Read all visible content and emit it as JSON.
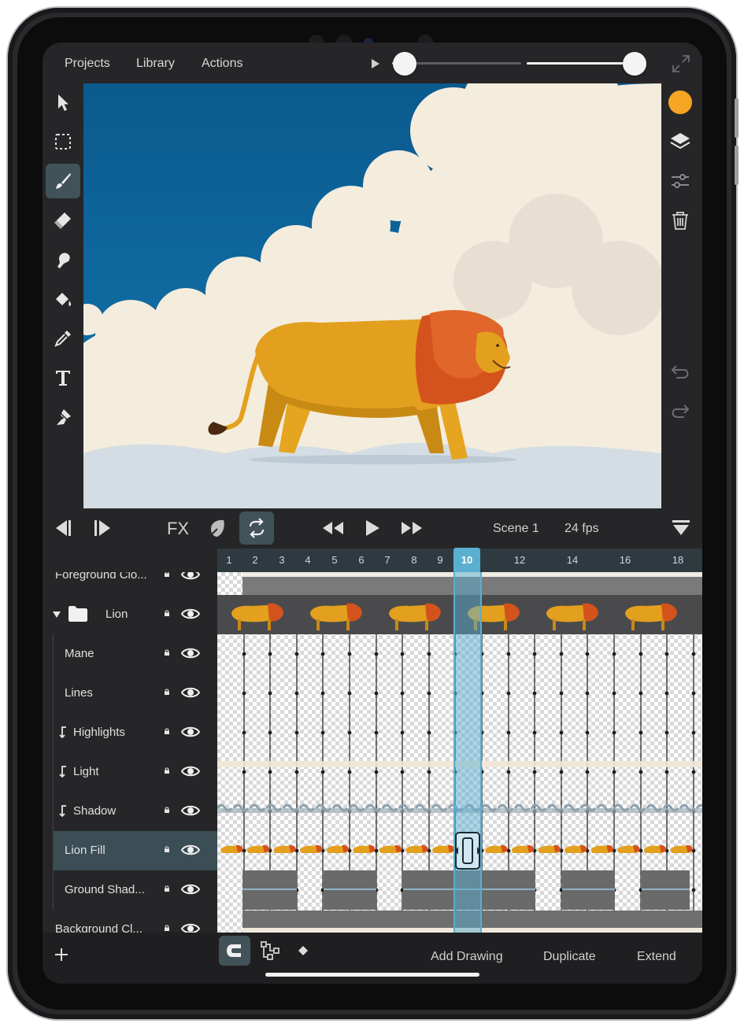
{
  "menu": {
    "projects": "Projects",
    "library": "Library",
    "actions": "Actions"
  },
  "playback": {
    "onion_slider_level": 0.1,
    "opacity_slider_level": 0.98
  },
  "tools": {
    "left": [
      "select-arrow-icon",
      "marquee-select-icon",
      "brush-icon",
      "eraser-icon",
      "smudge-icon",
      "paint-bucket-icon",
      "eyedropper-icon",
      "text-icon",
      "pen-icon"
    ],
    "active": "brush-icon",
    "right": [
      "color-swatch",
      "layers-icon",
      "adjust-sliders-icon",
      "trash-icon",
      "undo-icon",
      "redo-icon"
    ]
  },
  "colors": {
    "current_color": "#F6A624",
    "accent": "#5aaed0",
    "active_row": "#3b4d55"
  },
  "controls": {
    "fx_label": "FX",
    "scene_label": "Scene 1",
    "fps_label": "24 fps"
  },
  "ruler": {
    "frames": [
      "1",
      "2",
      "3",
      "4",
      "5",
      "6",
      "7",
      "8",
      "9",
      "10",
      "12",
      "14",
      "16",
      "18"
    ],
    "current_frame": "10"
  },
  "layers": [
    {
      "name": "Foreground Clo..."
    },
    {
      "name": "Lion"
    },
    {
      "name": "Mane"
    },
    {
      "name": "Lines"
    },
    {
      "name": "Highlights"
    },
    {
      "name": "Light"
    },
    {
      "name": "Shadow"
    },
    {
      "name": "Lion Fill"
    },
    {
      "name": "Ground Shad..."
    },
    {
      "name": "Background Cl..."
    }
  ],
  "bottom": {
    "add_drawing": "Add Drawing",
    "duplicate": "Duplicate",
    "extend": "Extend"
  }
}
